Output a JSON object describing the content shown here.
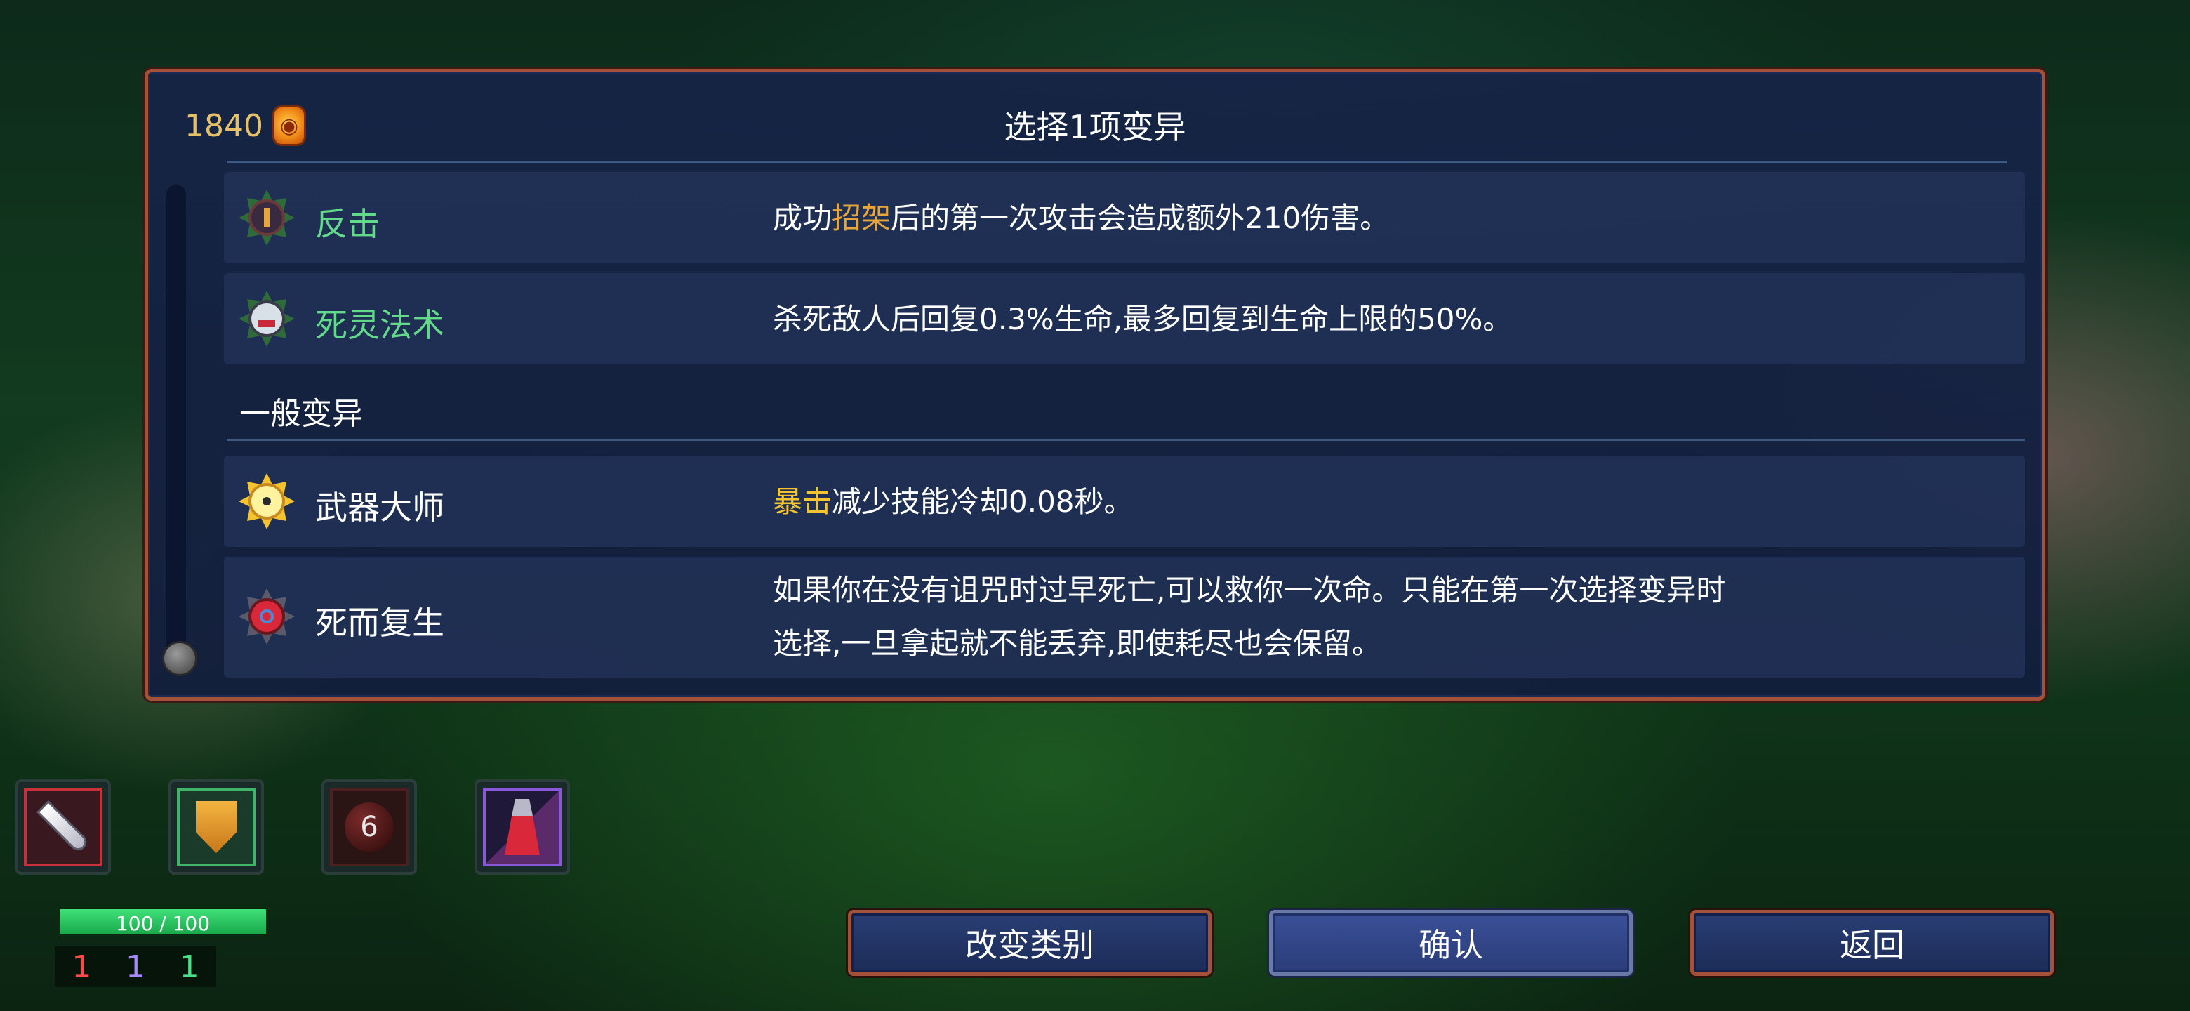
{
  "panel": {
    "title": "选择1项变异",
    "currency": {
      "value": "1840",
      "icon": "cells-currency-icon"
    },
    "section_label": "一般变异"
  },
  "mutations": [
    {
      "name": "反击",
      "icon": "parry-shield-icon",
      "desc_parts": [
        "成功",
        "招架",
        "后的第一次攻击会造成额外210伤害。"
      ]
    },
    {
      "name": "死灵法术",
      "icon": "skull-icon",
      "desc": "杀死敌人后回复0.3%生命,最多回复到生命上限的50%。"
    },
    {
      "name": "武器大师",
      "icon": "target-burst-icon",
      "desc_parts": [
        "暴击",
        "减少技能冷却0.08秒。"
      ]
    },
    {
      "name": "死而复生",
      "icon": "heart-revive-icon",
      "desc_line1": "如果你在没有诅咒时过早死亡,可以救你一次命。只能在第一次选择变异时",
      "desc_line2": "选择,一旦拿起就不能丢弃,即使耗尽也会保留。"
    }
  ],
  "hud": {
    "slots": [
      {
        "icon": "blade-icon",
        "color": "#c8303a"
      },
      {
        "icon": "shield-icon",
        "color": "#3fb46a"
      },
      {
        "icon": "bomb-icon",
        "color": "#4a2020",
        "count": "6"
      },
      {
        "icon": "turret-icon",
        "color": "#8a58d8"
      }
    ],
    "health": {
      "text": "100 / 100",
      "current": 100,
      "max": 100
    },
    "stats": {
      "brutality": "1",
      "tactics": "1",
      "survival": "1"
    }
  },
  "buttons": {
    "change_category": "改变类别",
    "confirm": "确认",
    "back": "返回"
  },
  "colors": {
    "panel_border": "#a4513a",
    "highlight_green": "#63d98a",
    "highlight_orange": "#e7a63c",
    "highlight_yellow": "#f4c430"
  }
}
